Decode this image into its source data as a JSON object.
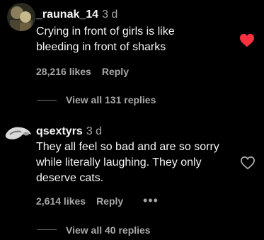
{
  "comments": [
    {
      "username": "_raunak_14",
      "time": "3 d",
      "lines": [
        "Crying in front of girls is like",
        "bleeding in front of sharks"
      ],
      "likes": "28,216 likes",
      "reply_label": "Reply",
      "view_replies": "View all 131 replies",
      "liked": true
    },
    {
      "username": "qsextyrs",
      "time": "3 d",
      "lines": [
        "They all feel so bad and are so sorry",
        "while literally laughing. They only",
        "deserve cats."
      ],
      "likes": "2,614 likes",
      "reply_label": "Reply",
      "more_label": "•••",
      "view_replies": "View all 40 replies",
      "liked": false
    }
  ],
  "colors": {
    "background": "#000000",
    "text": "#f5f5f5",
    "muted": "#a8a8a8",
    "liked_heart": "#ff3040"
  },
  "icons": {
    "liked": "heart-filled-icon",
    "unliked": "heart-outline-icon"
  }
}
